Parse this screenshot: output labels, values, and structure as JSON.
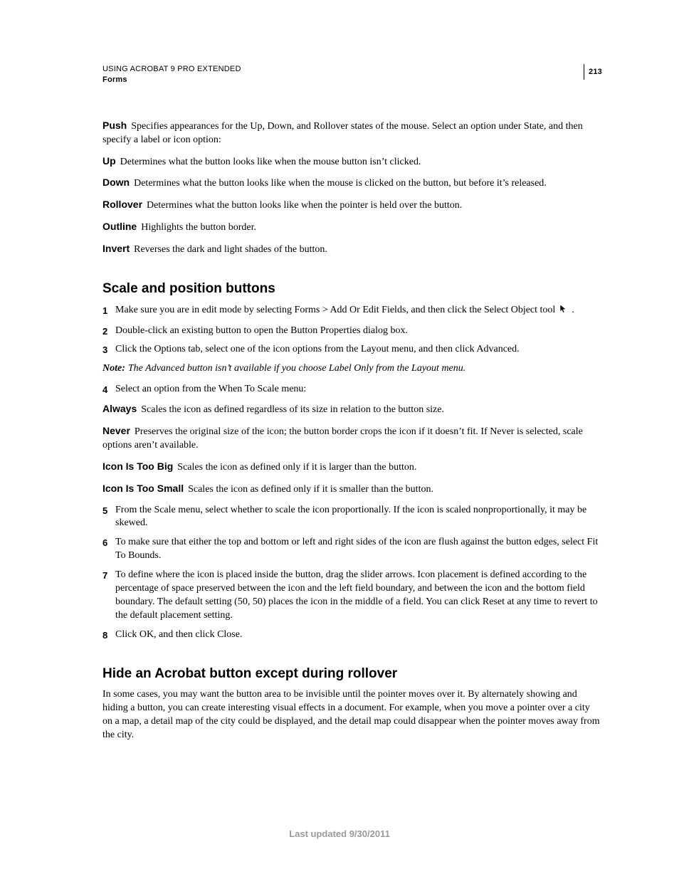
{
  "header": {
    "title": "USING ACROBAT 9 PRO EXTENDED",
    "section": "Forms",
    "page_number": "213"
  },
  "defs1": [
    {
      "term": "Push",
      "text": "Specifies appearances for the Up, Down, and Rollover states of the mouse. Select an option under State, and then specify a label or icon option:"
    },
    {
      "term": "Up",
      "text": "Determines what the button looks like when the mouse button isn’t clicked."
    },
    {
      "term": "Down",
      "text": "Determines what the button looks like when the mouse is clicked on the button, but before it’s released."
    },
    {
      "term": "Rollover",
      "text": "Determines what the button looks like when the pointer is held over the button."
    },
    {
      "term": "Outline",
      "text": "Highlights the button border."
    },
    {
      "term": "Invert",
      "text": "Reverses the dark and light shades of the button."
    }
  ],
  "heading1": "Scale and position buttons",
  "steps1": [
    {
      "n": "1",
      "text": "Make sure you are in edit mode by selecting Forms > Add Or Edit Fields, and then click the Select Object tool",
      "icon": "cursor",
      "tail": " ."
    },
    {
      "n": "2",
      "text": "Double-click an existing button to open the Button Properties dialog box."
    },
    {
      "n": "3",
      "text": "Click the Options tab, select one of the icon options from the Layout menu, and then click Advanced."
    }
  ],
  "note1": {
    "label": "Note:",
    "text": "The Advanced button isn’t available if you choose Label Only from the Layout menu."
  },
  "step4": {
    "n": "4",
    "text": "Select an option from the When To Scale menu:"
  },
  "defs2": [
    {
      "term": "Always",
      "text": "Scales the icon as defined regardless of its size in relation to the button size."
    },
    {
      "term": "Never",
      "text": "Preserves the original size of the icon; the button border crops the icon if it doesn’t fit. If Never is selected, scale options aren’t available."
    },
    {
      "term": "Icon Is Too Big",
      "text": "Scales the icon as defined only if it is larger than the button."
    },
    {
      "term": "Icon Is Too Small",
      "text": "Scales the icon as defined only if it is smaller than the button."
    }
  ],
  "steps2": [
    {
      "n": "5",
      "text": "From the Scale menu, select whether to scale the icon proportionally. If the icon is scaled nonproportionally, it may be skewed."
    },
    {
      "n": "6",
      "text": "To make sure that either the top and bottom or left and right sides of the icon are flush against the button edges, select Fit To Bounds."
    },
    {
      "n": "7",
      "text": "To define where the icon is placed inside the button, drag the slider arrows. Icon placement is defined according to the percentage of space preserved between the icon and the left field boundary, and between the icon and the bottom field boundary. The default setting (50, 50) places the icon in the middle of a field. You can click Reset at any time to revert to the default placement setting."
    },
    {
      "n": "8",
      "text": "Click OK, and then click Close."
    }
  ],
  "heading2": "Hide an Acrobat button except during rollover",
  "para2": "In some cases, you may want the button area to be invisible until the pointer moves over it. By alternately showing and hiding a button, you can create interesting visual effects in a document. For example, when you move a pointer over a city on a map, a detail map of the city could be displayed, and the detail map could disappear when the pointer moves away from the city.",
  "footer": "Last updated 9/30/2011"
}
